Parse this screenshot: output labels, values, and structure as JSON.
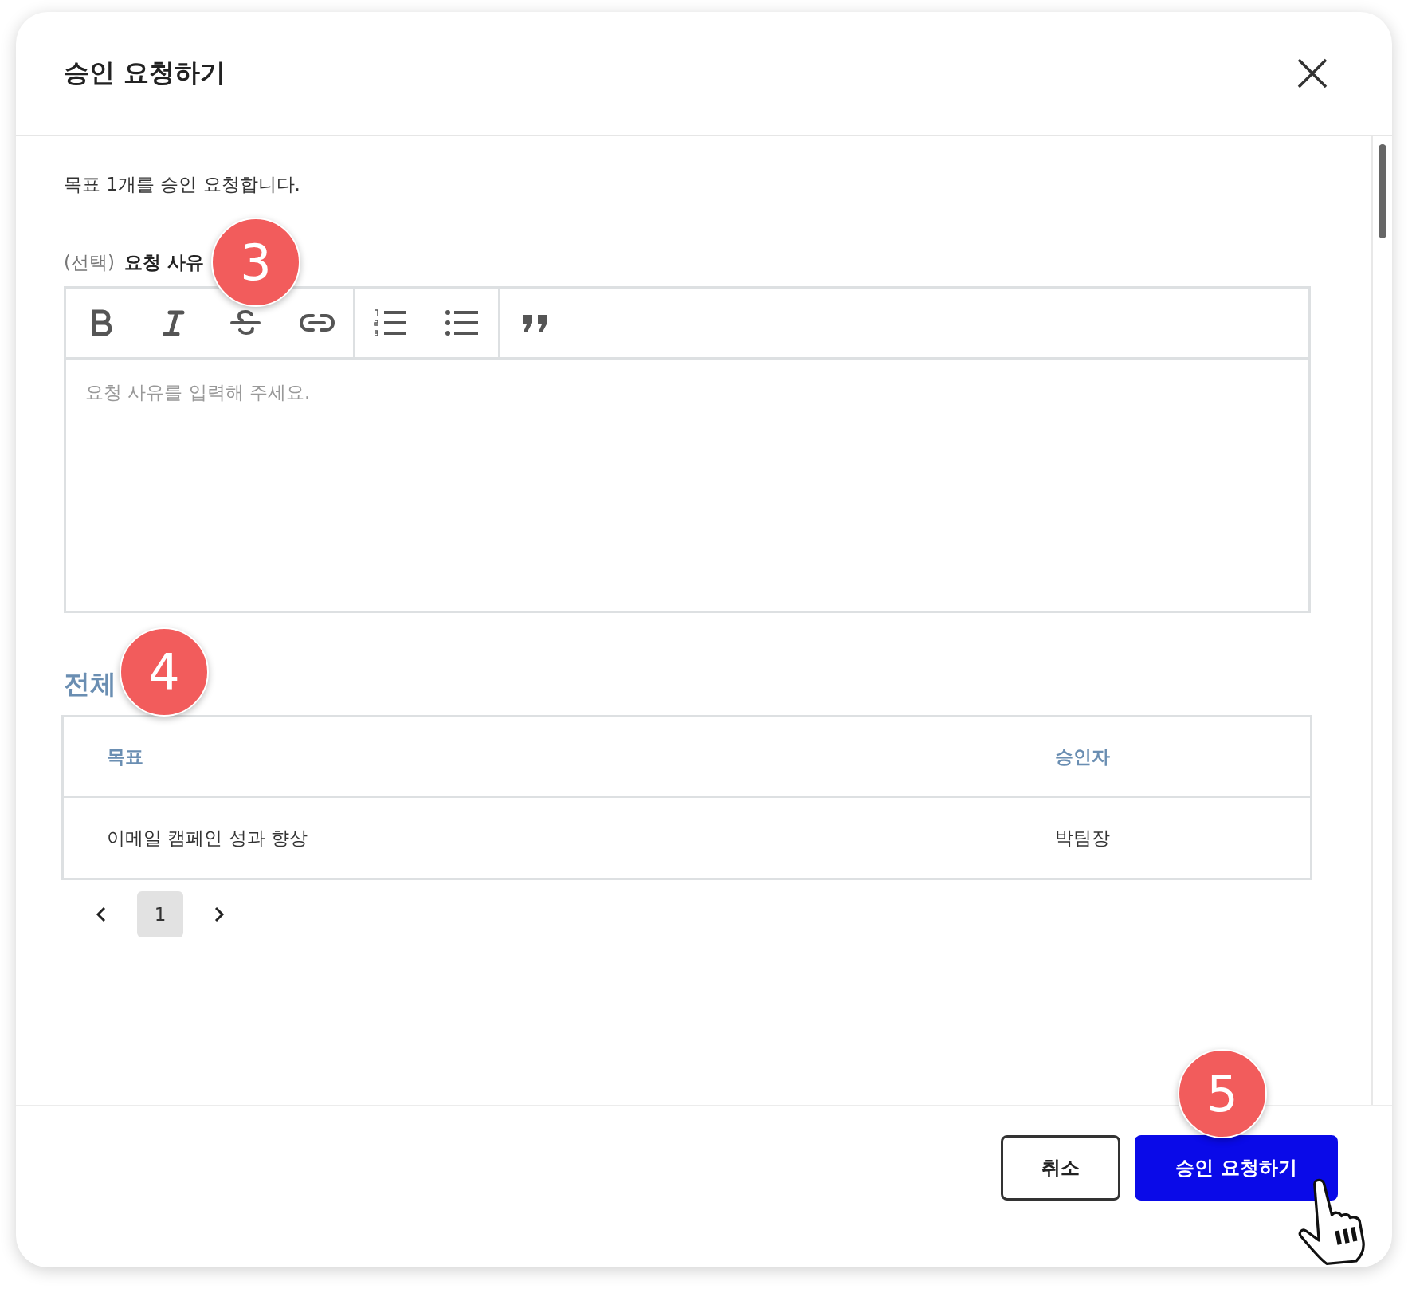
{
  "dialog": {
    "title": "승인 요청하기"
  },
  "description": "목표 1개를 승인 요청합니다.",
  "reason": {
    "optional_label": "(선택)",
    "label": "요청 사유",
    "callout": "3",
    "placeholder": "요청 사유를 입력해 주세요.",
    "toolbar": [
      [
        {
          "kind": "bold"
        },
        {
          "kind": "italic"
        },
        {
          "kind": "strike"
        },
        {
          "kind": "link"
        }
      ],
      [
        {
          "kind": "ordered"
        },
        {
          "kind": "bullet"
        }
      ],
      [
        {
          "kind": "quote"
        }
      ]
    ]
  },
  "table": {
    "title": "전체",
    "callout": "4",
    "columns": [
      "목표",
      "승인자"
    ],
    "rows": [
      [
        "이메일 캠페인 성과 향상",
        "박팀장"
      ]
    ]
  },
  "pagination": {
    "pages": [
      {
        "label": "1",
        "selected": true
      }
    ]
  },
  "buttons": [
    {
      "label": "취소",
      "kind": "secondary"
    },
    {
      "label": "승인 요청하기",
      "kind": "primary",
      "callout": "5"
    }
  ]
}
